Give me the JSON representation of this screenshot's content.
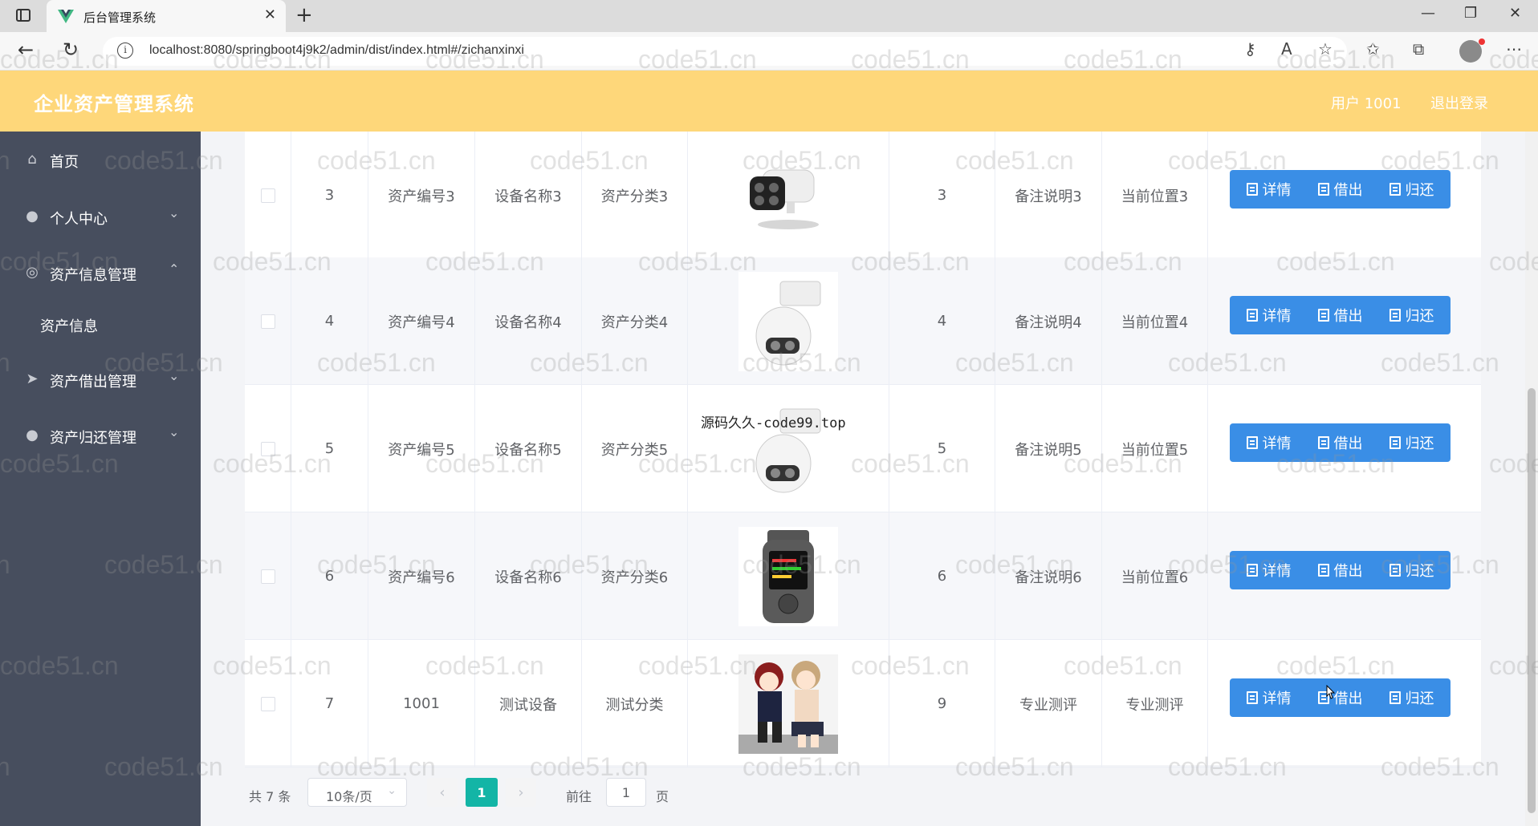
{
  "browser": {
    "tab_title": "后台管理系统",
    "url": "localhost:8080/springboot4j9k2/admin/dist/index.html#/zichanxinxi"
  },
  "header": {
    "title": "企业资产管理系统",
    "user_label": "用户 1001",
    "logout_label": "退出登录"
  },
  "sidebar": {
    "items": [
      {
        "label": "首页",
        "icon": "home-icon"
      },
      {
        "label": "个人中心",
        "icon": "user-icon",
        "expandable": true
      },
      {
        "label": "资产信息管理",
        "icon": "settings-icon",
        "expanded": true
      },
      {
        "label": "资产信息",
        "sub": true
      },
      {
        "label": "资产借出管理",
        "icon": "send-icon",
        "expandable": true
      },
      {
        "label": "资产归还管理",
        "icon": "user-icon",
        "expandable": true
      }
    ]
  },
  "actions": {
    "detail": "详情",
    "borrow": "借出",
    "return": "归还"
  },
  "table": {
    "rows": [
      {
        "idx": "3",
        "code": "资产编号3",
        "name": "设备名称3",
        "category": "资产分类3",
        "image": "bullet-camera",
        "qty": "3",
        "remark": "备注说明3",
        "location": "当前位置3"
      },
      {
        "idx": "4",
        "code": "资产编号4",
        "name": "设备名称4",
        "category": "资产分类4",
        "image": "dome-camera",
        "qty": "4",
        "remark": "备注说明4",
        "location": "当前位置4"
      },
      {
        "idx": "5",
        "code": "资产编号5",
        "name": "设备名称5",
        "category": "资产分类5",
        "image": "dome-camera",
        "qty": "5",
        "remark": "备注说明5",
        "location": "当前位置5"
      },
      {
        "idx": "6",
        "code": "资产编号6",
        "name": "设备名称6",
        "category": "资产分类6",
        "image": "voice-recorder",
        "qty": "6",
        "remark": "备注说明6",
        "location": "当前位置6"
      },
      {
        "idx": "7",
        "code": "1001",
        "name": "测试设备",
        "category": "测试分类",
        "image": "anime-girls",
        "qty": "9",
        "remark": "专业测评",
        "location": "专业测评"
      }
    ]
  },
  "pagination": {
    "total": "共 7 条",
    "page_size": "10条/页",
    "current": "1",
    "goto_label": "前往",
    "goto_value": "1",
    "page_suffix": "页"
  },
  "overlay_text": "源码久久-code99.top",
  "watermark": "code51.cn",
  "colors": {
    "header": "#fed77a",
    "sidebar": "#474e5e",
    "button": "#3a8ee6",
    "pager_active": "#13b5a6"
  }
}
